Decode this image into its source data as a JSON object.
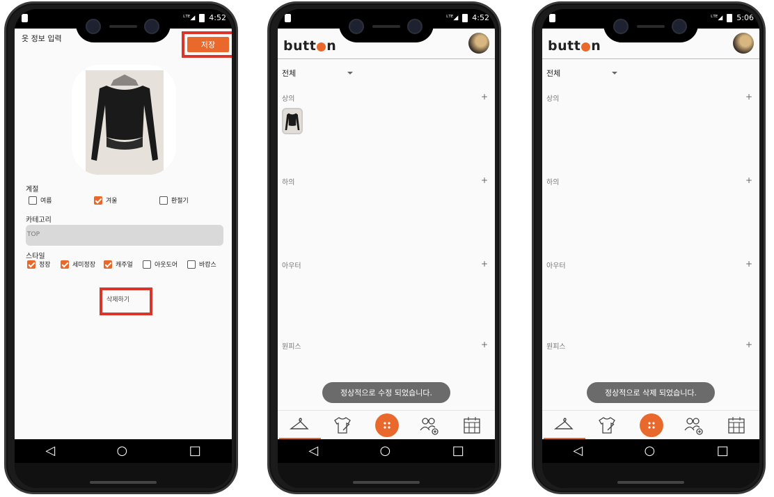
{
  "phone1": {
    "status_time": "4:52",
    "title": "옷 정보 입력",
    "save_label": "저장",
    "season_label": "계절",
    "seasons": [
      {
        "label": "여름",
        "checked": false
      },
      {
        "label": "겨울",
        "checked": true
      },
      {
        "label": "환절기",
        "checked": false
      }
    ],
    "category_label": "카테고리",
    "category_value": "TOP",
    "style_label": "스타일",
    "styles": [
      {
        "label": "정장",
        "checked": true
      },
      {
        "label": "세미정장",
        "checked": true
      },
      {
        "label": "캐주얼",
        "checked": true
      },
      {
        "label": "아웃도어",
        "checked": false
      },
      {
        "label": "바캉스",
        "checked": false
      }
    ],
    "delete_label": "삭제하기"
  },
  "phone2": {
    "status_time": "4:52",
    "logo_left": "butt",
    "logo_right": "n",
    "filter": "전체",
    "sections": [
      "상의",
      "하의",
      "아우터",
      "원피스"
    ],
    "plus": "+",
    "toast": "정상적으로 수정 되었습니다."
  },
  "phone3": {
    "status_time": "5:06",
    "logo_left": "butt",
    "logo_right": "n",
    "filter": "전체",
    "sections": [
      "상의",
      "하의",
      "아우터",
      "원피스"
    ],
    "plus": "+",
    "toast": "정상적으로 삭제 되었습니다."
  },
  "nav": {
    "back": "◁",
    "home": "○",
    "recent": "□"
  },
  "colors": {
    "accent": "#e8692b",
    "highlight": "#d9352b"
  },
  "icons": [
    "hanger-icon",
    "shirt-edit-icon",
    "button-icon",
    "friends-add-icon",
    "calendar-icon"
  ]
}
